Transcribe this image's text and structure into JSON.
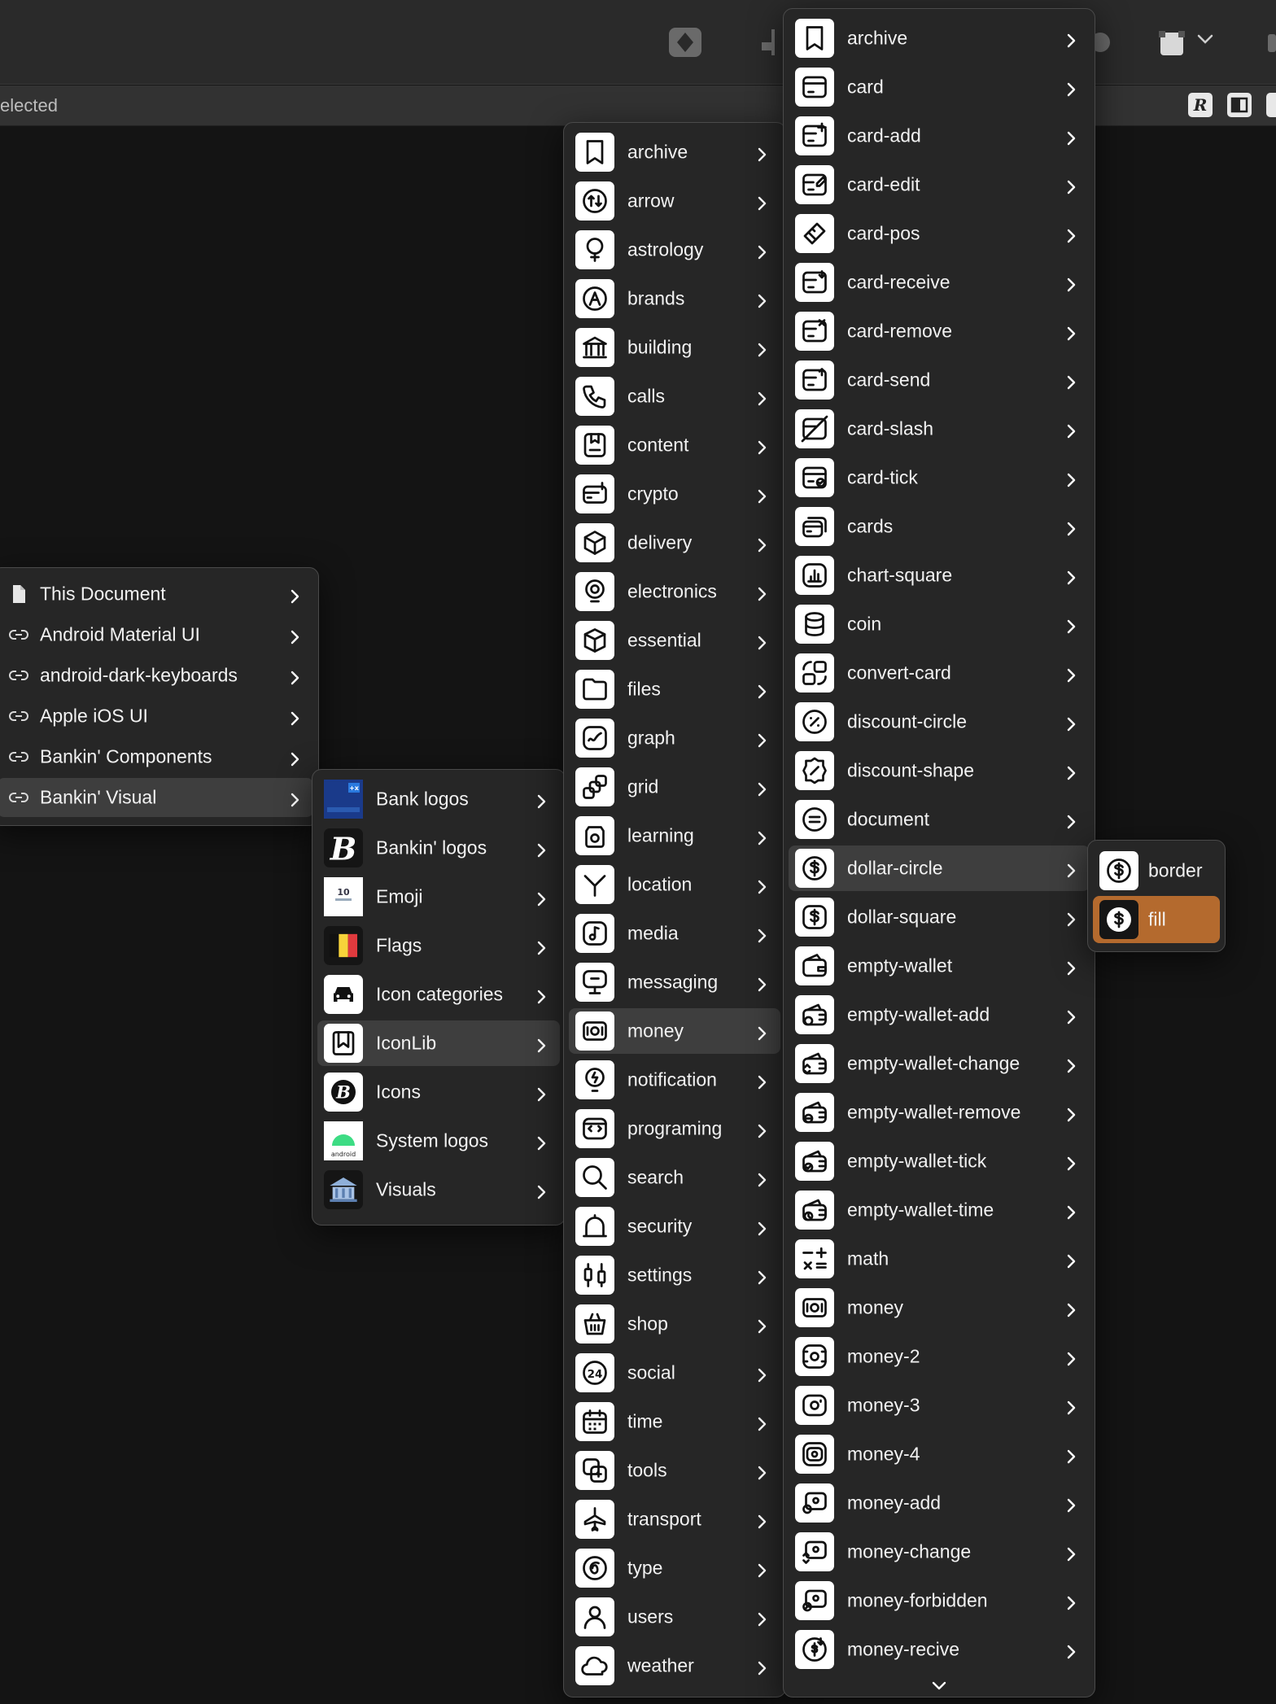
{
  "subbar": {
    "text": "elected"
  },
  "colors": {
    "selected_item": "#b46a2e",
    "highlight_item": "#3e3e3e",
    "menu_bg": "#262626"
  },
  "menu_libraries": {
    "items": [
      {
        "label": "This Document",
        "icon": "document-icon"
      },
      {
        "label": "Android Material UI",
        "icon": "link-icon"
      },
      {
        "label": "android-dark-keyboards",
        "icon": "link-icon"
      },
      {
        "label": "Apple iOS UI",
        "icon": "link-icon"
      },
      {
        "label": "Bankin' Components",
        "icon": "link-icon"
      },
      {
        "label": "Bankin' Visual",
        "icon": "link-icon",
        "state": "highlighted"
      }
    ]
  },
  "menu_visual": {
    "items": [
      {
        "label": "Bank logos",
        "icon": "bank-logo-icon"
      },
      {
        "label": "Bankin' logos",
        "icon": "bankin-b-icon"
      },
      {
        "label": "Emoji",
        "icon": "emoji-icon"
      },
      {
        "label": "Flags",
        "icon": "belgium-flag-icon"
      },
      {
        "label": "Icon categories",
        "icon": "car-icon"
      },
      {
        "label": "IconLib",
        "icon": "bookmark-icon",
        "state": "highlighted"
      },
      {
        "label": "Icons",
        "icon": "bankin-b-circle-icon"
      },
      {
        "label": "System logos",
        "icon": "android-icon"
      },
      {
        "label": "Visuals",
        "icon": "bank-building-icon"
      }
    ],
    "android_text": "android",
    "emoji_text": "10"
  },
  "menu_categories": {
    "items": [
      {
        "label": "archive",
        "icon": "archive-icon"
      },
      {
        "label": "arrow",
        "icon": "arrow-icon"
      },
      {
        "label": "astrology",
        "icon": "astrology-icon"
      },
      {
        "label": "brands",
        "icon": "brands-icon"
      },
      {
        "label": "building",
        "icon": "building-icon"
      },
      {
        "label": "calls",
        "icon": "calls-icon"
      },
      {
        "label": "content",
        "icon": "content-icon"
      },
      {
        "label": "crypto",
        "icon": "crypto-icon"
      },
      {
        "label": "delivery",
        "icon": "delivery-icon"
      },
      {
        "label": "electronics",
        "icon": "electronics-icon"
      },
      {
        "label": "essential",
        "icon": "essential-icon"
      },
      {
        "label": "files",
        "icon": "files-icon"
      },
      {
        "label": "graph",
        "icon": "graph-icon"
      },
      {
        "label": "grid",
        "icon": "grid-icon"
      },
      {
        "label": "learning",
        "icon": "learning-icon"
      },
      {
        "label": "location",
        "icon": "location-icon"
      },
      {
        "label": "media",
        "icon": "media-icon"
      },
      {
        "label": "messaging",
        "icon": "messaging-icon"
      },
      {
        "label": "money",
        "icon": "money-icon",
        "state": "highlighted"
      },
      {
        "label": "notification",
        "icon": "notification-icon"
      },
      {
        "label": "programing",
        "icon": "programing-icon"
      },
      {
        "label": "search",
        "icon": "search-icon"
      },
      {
        "label": "security",
        "icon": "security-icon"
      },
      {
        "label": "settings",
        "icon": "settings-icon"
      },
      {
        "label": "shop",
        "icon": "shop-icon"
      },
      {
        "label": "social",
        "icon": "social-icon"
      },
      {
        "label": "time",
        "icon": "time-icon"
      },
      {
        "label": "tools",
        "icon": "tools-icon"
      },
      {
        "label": "transport",
        "icon": "transport-icon"
      },
      {
        "label": "type",
        "icon": "type-icon"
      },
      {
        "label": "users",
        "icon": "users-icon"
      },
      {
        "label": "weather",
        "icon": "weather-icon"
      }
    ],
    "social_text": "24"
  },
  "menu_money": {
    "items": [
      {
        "label": "archive",
        "icon": "archive-icon"
      },
      {
        "label": "card",
        "icon": "card-icon"
      },
      {
        "label": "card-add",
        "icon": "card-add-icon"
      },
      {
        "label": "card-edit",
        "icon": "card-edit-icon"
      },
      {
        "label": "card-pos",
        "icon": "card-pos-icon"
      },
      {
        "label": "card-receive",
        "icon": "card-receive-icon"
      },
      {
        "label": "card-remove",
        "icon": "card-remove-icon"
      },
      {
        "label": "card-send",
        "icon": "card-send-icon"
      },
      {
        "label": "card-slash",
        "icon": "card-slash-icon"
      },
      {
        "label": "card-tick",
        "icon": "card-tick-icon"
      },
      {
        "label": "cards",
        "icon": "cards-icon"
      },
      {
        "label": "chart-square",
        "icon": "chart-square-icon"
      },
      {
        "label": "coin",
        "icon": "coin-icon"
      },
      {
        "label": "convert-card",
        "icon": "convert-card-icon"
      },
      {
        "label": "discount-circle",
        "icon": "discount-circle-icon"
      },
      {
        "label": "discount-shape",
        "icon": "discount-shape-icon"
      },
      {
        "label": "document",
        "icon": "document-icon"
      },
      {
        "label": "dollar-circle",
        "icon": "dollar-circle-icon",
        "state": "highlighted"
      },
      {
        "label": "dollar-square",
        "icon": "dollar-square-icon"
      },
      {
        "label": "empty-wallet",
        "icon": "wallet-icon"
      },
      {
        "label": "empty-wallet-add",
        "icon": "wallet-add-icon"
      },
      {
        "label": "empty-wallet-change",
        "icon": "wallet-change-icon"
      },
      {
        "label": "empty-wallet-remove",
        "icon": "wallet-remove-icon"
      },
      {
        "label": "empty-wallet-tick",
        "icon": "wallet-tick-icon"
      },
      {
        "label": "empty-wallet-time",
        "icon": "wallet-time-icon"
      },
      {
        "label": "math",
        "icon": "math-icon"
      },
      {
        "label": "money",
        "icon": "money-icon"
      },
      {
        "label": "money-2",
        "icon": "money-2-icon"
      },
      {
        "label": "money-3",
        "icon": "money-3-icon"
      },
      {
        "label": "money-4",
        "icon": "money-4-icon"
      },
      {
        "label": "money-add",
        "icon": "money-add-icon"
      },
      {
        "label": "money-change",
        "icon": "money-change-icon"
      },
      {
        "label": "money-forbidden",
        "icon": "money-forbidden-icon"
      },
      {
        "label": "money-recive",
        "icon": "money-recive-icon"
      }
    ]
  },
  "menu_variant": {
    "items": [
      {
        "label": "border",
        "icon": "dollar-circle-icon"
      },
      {
        "label": "fill",
        "icon": "dollar-circle-fill-icon",
        "state": "selected"
      }
    ]
  }
}
